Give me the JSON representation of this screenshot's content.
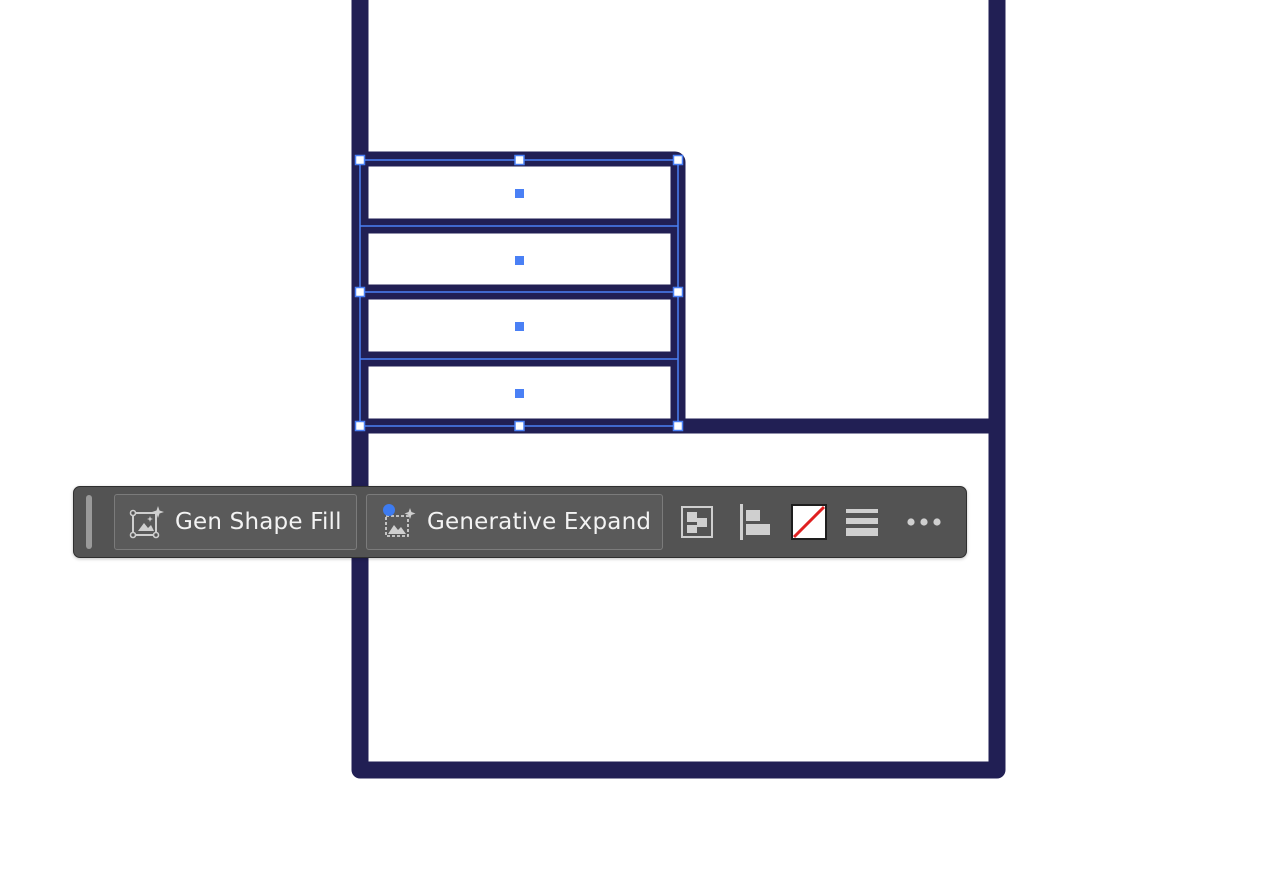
{
  "canvas": {
    "stroke_color": "#211f54",
    "selection_color": "#4a80f5"
  },
  "toolbar": {
    "gen_shape_fill": {
      "label": "Gen Shape Fill",
      "icon": "gen-shape-fill-icon"
    },
    "generative_expand": {
      "label": "Generative Expand",
      "icon": "generative-expand-icon",
      "badge_color": "#3d7bf0"
    },
    "icons": [
      "arrange-icon",
      "align-left-icon",
      "no-fill-swatch-icon",
      "stroke-weight-icon",
      "more-options-icon"
    ],
    "background": "#535353",
    "text_color": "#f3f3f3"
  }
}
